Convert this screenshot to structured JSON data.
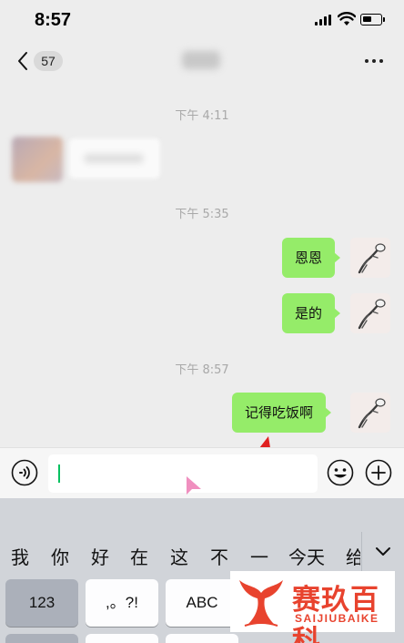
{
  "status_bar": {
    "time": "8:57"
  },
  "header": {
    "unread_count": "57"
  },
  "timestamps": [
    "下午 4:11",
    "下午 5:35",
    "下午 8:57"
  ],
  "messages": [
    {
      "direction": "sent",
      "text": "恩恩"
    },
    {
      "direction": "sent",
      "text": "是的"
    },
    {
      "direction": "sent",
      "text": "记得吃饭啊"
    }
  ],
  "keyboard": {
    "candidates": [
      "我",
      "你",
      "好",
      "在",
      "这",
      "不",
      "一",
      "今天",
      "给"
    ],
    "keys": {
      "numbers": "123",
      "punct": ",。?!",
      "abc": "ABC"
    }
  },
  "watermark": {
    "text": "赛玖百科",
    "subtext": "SAIJIUBAIKE"
  },
  "colors": {
    "sent_bubble": "#95ec69",
    "background": "#ededed",
    "caret": "#07c160",
    "annotation_arrow": "#e02020",
    "watermark": "#e8432e"
  }
}
